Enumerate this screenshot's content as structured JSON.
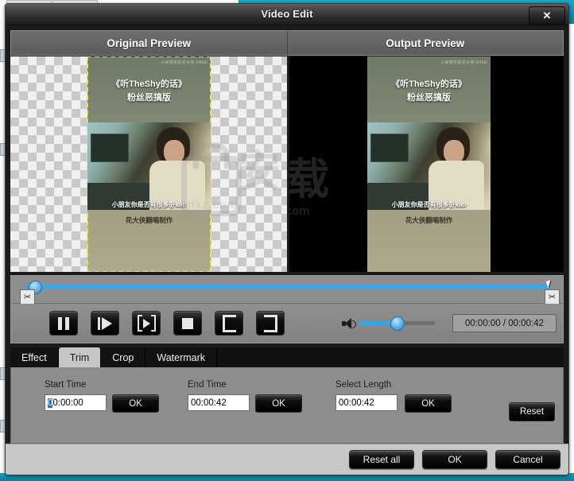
{
  "window": {
    "title": "Video Edit",
    "close_label": "✕"
  },
  "preview": {
    "tabs": [
      {
        "label": "Original Preview"
      },
      {
        "label": "Output Preview"
      }
    ],
    "video": {
      "brand": "火树银花的花大侠   bilibili",
      "title_line1": "《听TheShy的话》",
      "title_line2": "粉丝恶搞版",
      "subtitle": "小朋友你是否有很多卧kao",
      "credit": "花大侠翻唱制作"
    },
    "watermark_text": "anxz.com"
  },
  "timeline": {
    "position_percent": 0,
    "cut_start_icon": "scissors-icon",
    "cut_end_icon": "scissors-icon"
  },
  "transport": {
    "buttons": [
      {
        "name": "pause-button",
        "icon": "pause-icon"
      },
      {
        "name": "play-button",
        "icon": "play-icon"
      },
      {
        "name": "play-next-button",
        "icon": "play-frame-icon"
      },
      {
        "name": "stop-button",
        "icon": "stop-icon"
      },
      {
        "name": "set-start-button",
        "icon": "bracket-left-icon"
      },
      {
        "name": "set-end-button",
        "icon": "bracket-right-icon"
      }
    ],
    "volume": {
      "icon": "speaker-icon",
      "level_percent": 45
    },
    "time_display": "00:00:00 / 00:00:42"
  },
  "tabs": [
    {
      "label": "Effect",
      "active": false
    },
    {
      "label": "Trim",
      "active": true
    },
    {
      "label": "Crop",
      "active": false
    },
    {
      "label": "Watermark",
      "active": false
    }
  ],
  "trim": {
    "start": {
      "label": "Start Time",
      "value_selected": "0",
      "value_rest": "0:00:00",
      "ok_label": "OK"
    },
    "end": {
      "label": "End Time",
      "value": "00:00:42",
      "ok_label": "OK"
    },
    "length": {
      "label": "Select Length",
      "value": "00:00:42",
      "ok_label": "OK"
    },
    "reset_label": "Reset"
  },
  "footer": {
    "reset_all_label": "Reset all",
    "ok_label": "OK",
    "cancel_label": "Cancel"
  },
  "colors": {
    "accent_blue": "#39a5e8",
    "dialog_gray": "#c8c8c8",
    "panel_gray": "#8d8d8d",
    "selection_blue": "#2f6fb5",
    "dashed_yellow": "#e8e84a"
  }
}
